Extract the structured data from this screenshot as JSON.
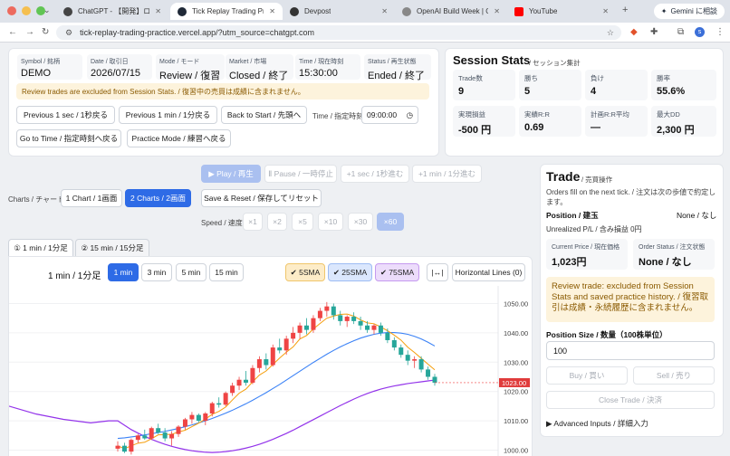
{
  "browser": {
    "tabs": [
      {
        "label": "ChatGPT - 【開発】ローソク",
        "active": false
      },
      {
        "label": "Tick Replay Trading Practic",
        "active": true
      },
      {
        "label": "Devpost",
        "active": false
      },
      {
        "label": "OpenAI Build Week | Oper",
        "active": false
      },
      {
        "label": "YouTube",
        "active": false
      }
    ],
    "new_tab": "+",
    "gemini_label": "Gemini に相談",
    "url": "tick-replay-trading-practice.vercel.app/?utm_source=chatgpt.com"
  },
  "info": {
    "fields": [
      {
        "label": "Symbol / 銘柄",
        "value": "DEMO"
      },
      {
        "label": "Date / 取引日",
        "value": "2026/07/15"
      },
      {
        "label": "Mode / モード",
        "value": "Review / 復習"
      },
      {
        "label": "Market / 市場",
        "value": "Closed / 終了"
      },
      {
        "label": "Time / 現在時刻",
        "value": "15:30:00"
      },
      {
        "label": "Status / 再生状態",
        "value": "Ended / 終了"
      }
    ],
    "banner": "Review trades are excluded from Session Stats. / 復習中の売買は成績に含まれません。"
  },
  "controls": {
    "prev_1sec": "Previous 1 sec / 1秒戻る",
    "prev_1min": "Previous 1 min / 1分戻る",
    "back_to_start": "Back to Start / 先頭へ",
    "time_label": "Time / 指定時刻",
    "time_value": "09:00:00",
    "go_to_time": "Go to Time / 指定時刻へ戻る",
    "practice_mode": "Practice Mode / 練習へ戻る"
  },
  "playback": {
    "play": "▶ Play / 再生",
    "pause": "Ⅱ Pause / 一時停止",
    "plus_1sec": "+1 sec / 1秒進む",
    "plus_1min": "+1 min / 1分進む",
    "charts_label": "Charts / チャート",
    "one_chart": "1 Chart / 1画面",
    "two_charts": "2 Charts / 2画面",
    "save_reset": "Save & Reset / 保存してリセット",
    "speed_label": "Speed / 速度",
    "speeds": [
      "×1",
      "×2",
      "×5",
      "×10",
      "×30",
      "×60"
    ]
  },
  "chart_tabs": [
    "① 1 min / 1分足",
    "② 15 min / 15分足"
  ],
  "chart_toolbar": {
    "title": "1 min / 1分足",
    "timeframes": [
      "1 min",
      "3 min",
      "5 min",
      "15 min"
    ],
    "sma5": "✔ 5SMA",
    "sma25": "✔ 25SMA",
    "sma75": "✔ 75SMA",
    "fit_icon": "|↔|",
    "horizontal_lines": "Horizontal Lines (0)"
  },
  "colors": {
    "sma5": "#f59e0b",
    "sma25": "#3b82f6",
    "sma75": "#9333ea",
    "up": "#ef4444",
    "down": "#26a69a",
    "accent": "#2e6be6"
  },
  "chart_data": {
    "type": "candlestick",
    "y_ticks": [
      "1050.00",
      "1040.00",
      "1030.00",
      "1020.00",
      "1010.00",
      "1000.00"
    ],
    "ylim": [
      998,
      1056
    ],
    "last_price_label": "1023.00",
    "candles": [
      [
        1000.5,
        1003,
        999.5,
        1001.5
      ],
      [
        1001.5,
        1002.5,
        999,
        999.5
      ],
      [
        999.5,
        1004,
        998.5,
        1003.5
      ],
      [
        1003.5,
        1005.5,
        1002.5,
        1005
      ],
      [
        1005,
        1007,
        1003.5,
        1004
      ],
      [
        1004,
        1008,
        1003.5,
        1007.5
      ],
      [
        1007.5,
        1009,
        1005.5,
        1006
      ],
      [
        1006,
        1007.5,
        1003,
        1004
      ],
      [
        1004,
        1006.5,
        1001.5,
        1005.5
      ],
      [
        1005.5,
        1008.5,
        1004.5,
        1008
      ],
      [
        1008,
        1011,
        1007,
        1010.5
      ],
      [
        1010.5,
        1013,
        1009,
        1012
      ],
      [
        1012,
        1012.5,
        1009.5,
        1010
      ],
      [
        1010,
        1013,
        1008.5,
        1012.5
      ],
      [
        1012.5,
        1016.5,
        1011.5,
        1016
      ],
      [
        1016,
        1018,
        1014.5,
        1015.5
      ],
      [
        1015.5,
        1020,
        1015,
        1019.5
      ],
      [
        1019.5,
        1023,
        1018.5,
        1022
      ],
      [
        1022,
        1025,
        1020.5,
        1024
      ],
      [
        1024,
        1027,
        1022,
        1023
      ],
      [
        1023,
        1029,
        1022.5,
        1028
      ],
      [
        1028,
        1032,
        1026.5,
        1031
      ],
      [
        1031,
        1033,
        1027.5,
        1029
      ],
      [
        1029,
        1036,
        1028.5,
        1035
      ],
      [
        1035,
        1038,
        1033,
        1034
      ],
      [
        1034,
        1039,
        1032.5,
        1038
      ],
      [
        1038,
        1042,
        1036.5,
        1040
      ],
      [
        1040,
        1043.5,
        1038,
        1042.5
      ],
      [
        1042.5,
        1045,
        1039.5,
        1041
      ],
      [
        1041,
        1046,
        1040,
        1045
      ],
      [
        1045,
        1048.5,
        1044,
        1047.5
      ],
      [
        1047.5,
        1050.5,
        1045.5,
        1049
      ],
      [
        1049,
        1050,
        1044.5,
        1046
      ],
      [
        1046,
        1047.5,
        1042.5,
        1044
      ],
      [
        1044,
        1046,
        1042,
        1045.5
      ],
      [
        1045.5,
        1047,
        1043,
        1044
      ],
      [
        1044,
        1045.5,
        1041,
        1042.5
      ],
      [
        1042.5,
        1044,
        1040,
        1041
      ],
      [
        1041,
        1043,
        1039.5,
        1042.5
      ],
      [
        1042.5,
        1043.5,
        1039,
        1040
      ],
      [
        1040,
        1041.5,
        1036.5,
        1037.5
      ],
      [
        1037.5,
        1038.5,
        1034,
        1035
      ],
      [
        1035,
        1036,
        1031.5,
        1032.5
      ],
      [
        1032.5,
        1034,
        1029,
        1030.5
      ],
      [
        1030.5,
        1032,
        1028,
        1031
      ],
      [
        1031,
        1032,
        1026.5,
        1027.5
      ],
      [
        1027.5,
        1028.5,
        1024,
        1025
      ],
      [
        1025,
        1026,
        1022,
        1023
      ]
    ],
    "sma25_values": [
      1004,
      1004.2,
      1004.5,
      1004.8,
      1005.2,
      1005.6,
      1006,
      1006.4,
      1006.9,
      1007.4,
      1008,
      1008.6,
      1009.3,
      1010,
      1010.8,
      1011.7,
      1012.6,
      1013.6,
      1014.7,
      1015.8,
      1017,
      1018.3,
      1019.6,
      1021,
      1022.4,
      1023.9,
      1025.4,
      1026.9,
      1028.4,
      1029.9,
      1031.3,
      1032.7,
      1034,
      1035.2,
      1036.3,
      1037.3,
      1038.2,
      1038.9,
      1039.5,
      1039.9,
      1040.1,
      1040.1,
      1039.9,
      1039.5,
      1038.8,
      1037.9,
      1036.8,
      1035.5
    ],
    "sma75_values": [
      1010,
      1008.5,
      1007,
      1005.8,
      1004.7,
      1003.7,
      1002.8,
      1002,
      1001.3,
      1000.7,
      1000.2,
      999.8,
      999.5,
      999.3,
      999.2,
      999.3,
      999.5,
      999.8,
      1000.2,
      1000.7,
      1001.3,
      1002,
      1002.8,
      1003.7,
      1004.7,
      1005.7,
      1006.8,
      1008,
      1009.2,
      1010.4,
      1011.6,
      1012.8,
      1014,
      1015.2,
      1016.3,
      1017.4,
      1018.4,
      1019.3,
      1020.1,
      1020.8,
      1021.4,
      1021.9,
      1022.3,
      1022.7,
      1023,
      1023.3,
      1023.6,
      1023.9
    ]
  },
  "session_stats": {
    "title": "Session Stats",
    "subtitle": "/ セッション集計",
    "items": [
      {
        "label": "Trade数",
        "value": "9"
      },
      {
        "label": "勝ち",
        "value": "5"
      },
      {
        "label": "負け",
        "value": "4"
      },
      {
        "label": "勝率",
        "value": "55.6%"
      },
      {
        "label": "実現損益",
        "value": "-500 円"
      },
      {
        "label": "実績R:R",
        "value": "0.69"
      },
      {
        "label": "計画R:R平均",
        "value": "—"
      },
      {
        "label": "最大DD",
        "value": "2,300 円"
      }
    ]
  },
  "trade": {
    "title": "Trade",
    "subtitle": "/ 売買操作",
    "note": "Orders fill on the next tick. / 注文は次の歩値で約定します。",
    "position_label": "Position / 建玉",
    "position_value": "None / なし",
    "unrealized": "Unrealized P/L / 含み損益 0円",
    "current_price_label": "Current Price / 現在価格",
    "current_price_value": "1,023円",
    "order_status_label": "Order Status / 注文状態",
    "order_status_value": "None / なし",
    "review_notice": "Review trade: excluded from Session Stats and saved practice history. / 復習取引は成績・永続履歴に含まれません。",
    "position_size_label": "Position Size / 数量（100株単位）",
    "position_size_value": "100",
    "buy": "Buy / 買い",
    "sell": "Sell / 売り",
    "close_trade": "Close Trade / 決済",
    "advanced": "▶ Advanced Inputs / 詳細入力"
  }
}
